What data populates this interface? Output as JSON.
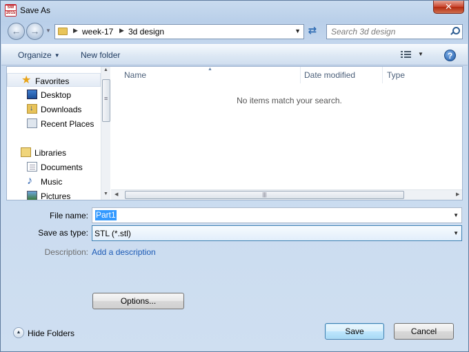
{
  "window": {
    "title": "Save As",
    "close_glyph": "✕",
    "app_icon_text": "SW",
    "app_icon_year": "2015"
  },
  "navbar": {
    "breadcrumbs": [
      "week-17",
      "3d design"
    ],
    "search_placeholder": "Search 3d design"
  },
  "toolbar": {
    "organize_label": "Organize",
    "new_folder_label": "New folder",
    "help_glyph": "?"
  },
  "sidebar": {
    "groups": [
      {
        "label": "Favorites",
        "icon": "star-icon",
        "items": [
          {
            "label": "Desktop",
            "icon": "desktop-icon"
          },
          {
            "label": "Downloads",
            "icon": "downloads-icon"
          },
          {
            "label": "Recent Places",
            "icon": "recent-places-icon"
          }
        ]
      },
      {
        "label": "Libraries",
        "icon": "libraries-icon",
        "items": [
          {
            "label": "Documents",
            "icon": "documents-icon"
          },
          {
            "label": "Music",
            "icon": "music-icon"
          },
          {
            "label": "Pictures",
            "icon": "pictures-icon"
          }
        ]
      }
    ]
  },
  "file_list": {
    "columns": [
      "Name",
      "Date modified",
      "Type"
    ],
    "empty_message": "No items match your search."
  },
  "form": {
    "file_name_label": "File name:",
    "file_name_value": "Part1",
    "save_as_type_label": "Save as type:",
    "save_as_type_value": "STL (*.stl)",
    "description_label": "Description:",
    "description_link": "Add a description"
  },
  "buttons": {
    "options": "Options...",
    "save": "Save",
    "cancel": "Cancel",
    "hide_folders": "Hide Folders"
  },
  "colors": {
    "accent": "#3399ff",
    "link": "#1c5ab5",
    "close_button": "#c9452d"
  }
}
